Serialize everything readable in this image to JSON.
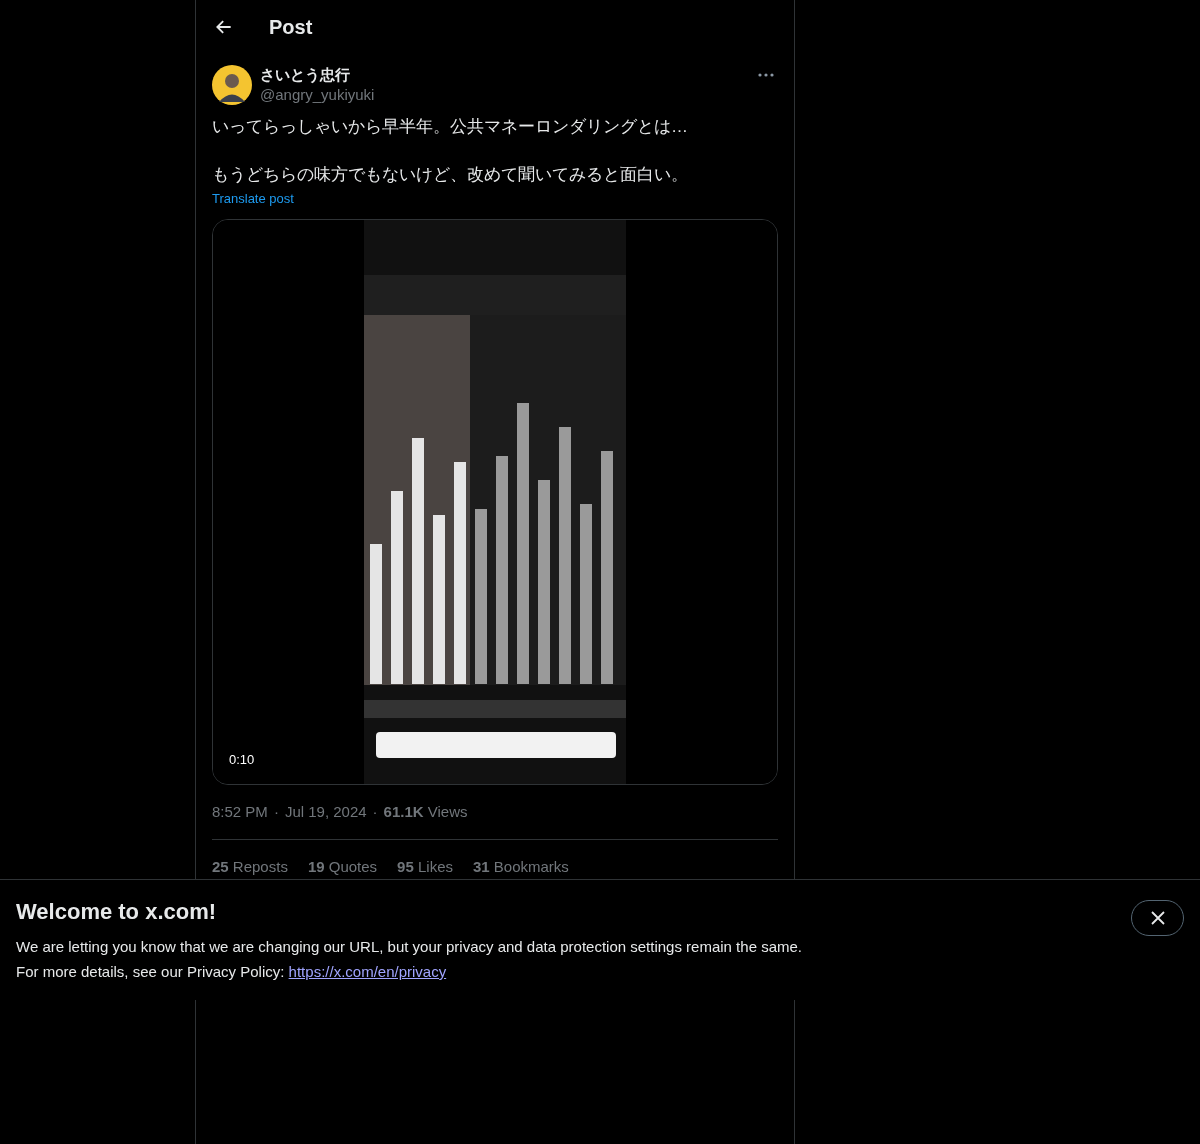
{
  "header": {
    "title": "Post"
  },
  "post": {
    "author": {
      "name": "さいとう忠行",
      "handle": "@angry_yukiyuki"
    },
    "paragraphs": [
      "いってらっしゃいから早半年。公共マネーロンダリングとは…",
      "もうどちらの味方でもないけど、改めて聞いてみると面白い。"
    ],
    "translate_link": "Translate post",
    "media": {
      "kind": "picture",
      "time": "0:10"
    },
    "time": "8:52 PM",
    "separators": [
      "·",
      "·"
    ],
    "date": "Jul 19, 2024",
    "views": "**61.1K** Views",
    "stats": [
      "**25** Reposts",
      "**19** Quotes",
      "**95** Likes",
      "**31** Bookmarks"
    ]
  },
  "banner": {
    "title": "Welcome to x.com!",
    "lines": [
      "We are letting you know that we are changing our URL, but your privacy and data protection settings remain the same."
    ],
    "policy_text": "For more details, see our Privacy Policy:",
    "policy_link": "https://x.com/en/privacy"
  }
}
